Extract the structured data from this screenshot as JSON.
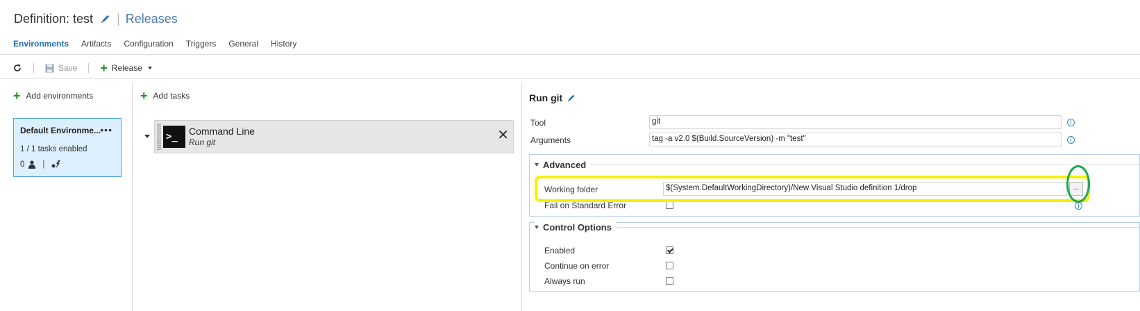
{
  "header": {
    "definition_title": "Definition: test",
    "separator": "|",
    "releases_link": "Releases"
  },
  "tabs": [
    {
      "label": "Environments",
      "active": true
    },
    {
      "label": "Artifacts"
    },
    {
      "label": "Configuration"
    },
    {
      "label": "Triggers"
    },
    {
      "label": "General"
    },
    {
      "label": "History"
    }
  ],
  "toolbar": {
    "refresh_icon": "refresh-icon",
    "save_label": "Save",
    "release_label": "Release"
  },
  "environments": {
    "add_label": "Add environments",
    "card": {
      "name": "Default Environme...",
      "menu": "•••",
      "tasks_enabled": "1 / 1 tasks enabled",
      "approvers_count": "0",
      "separator": "|"
    }
  },
  "tasks": {
    "add_label": "Add tasks",
    "items": [
      {
        "icon_glyph": ">_",
        "name": "Command Line",
        "subtitle": "Run git",
        "close": "✕"
      }
    ]
  },
  "task_detail": {
    "title": "Run git",
    "tool": {
      "label": "Tool",
      "value": "git"
    },
    "arguments": {
      "label": "Arguments",
      "value": "tag -a v2.0 $(Build.SourceVersion) -m \"test\""
    },
    "advanced": {
      "title": "Advanced",
      "working_folder": {
        "label": "Working folder",
        "value": "$(System.DefaultWorkingDirectory)/New Visual Studio definition 1/drop",
        "browse": "..."
      },
      "fail_on_stderr": {
        "label": "Fail on Standard Error",
        "checked": false
      }
    },
    "control_options": {
      "title": "Control Options",
      "enabled": {
        "label": "Enabled",
        "checked": true
      },
      "continue_on_error": {
        "label": "Continue on error",
        "checked": false
      },
      "always_run": {
        "label": "Always run",
        "checked": false
      }
    },
    "info_glyph": "i"
  },
  "colors": {
    "accent": "#1e6fb5",
    "highlight_yellow": "#f7f000",
    "highlight_green": "#1aa84a",
    "env_card_bg": "#dceffc"
  }
}
